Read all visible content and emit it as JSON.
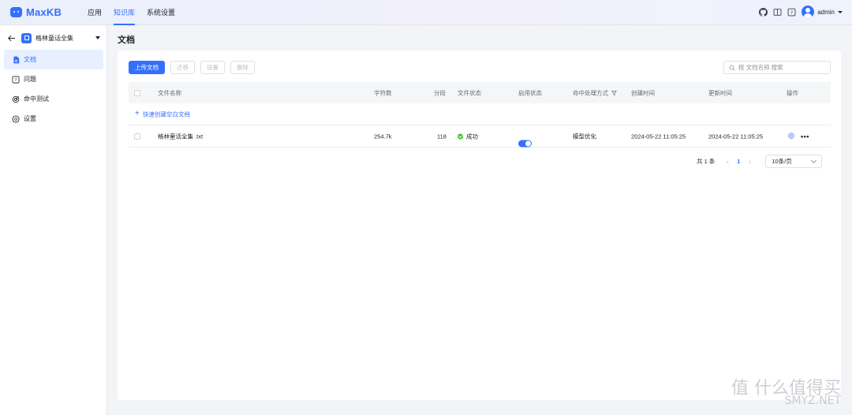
{
  "app": {
    "logo_text": "MaxKB"
  },
  "nav": {
    "items": [
      "应用",
      "知识库",
      "系统设置"
    ],
    "active": "知识库"
  },
  "user": {
    "name": "admin"
  },
  "sidebar": {
    "knowledge_base": "格林童话全集",
    "items": [
      {
        "label": "文档",
        "icon": "document-icon",
        "active": true
      },
      {
        "label": "问题",
        "icon": "question-icon",
        "active": false
      },
      {
        "label": "命中测试",
        "icon": "target-icon",
        "active": false
      },
      {
        "label": "设置",
        "icon": "gear-icon",
        "active": false
      }
    ]
  },
  "main": {
    "title": "文档",
    "toolbar": {
      "upload": "上传文档",
      "migrate": "迁移",
      "settings": "设置",
      "delete": "删除"
    },
    "search": {
      "placeholder": "按 文档名称 搜索"
    },
    "table": {
      "headers": {
        "name": "文件名称",
        "chars": "字符数",
        "segments": "分段",
        "file_status": "文件状态",
        "enable_status": "启用状态",
        "hit_mode": "命中处理方式",
        "created": "创建时间",
        "updated": "更新时间",
        "actions": "操作"
      },
      "quick_create": "快速创建空白文档",
      "rows": [
        {
          "name": "格林童话全集 .txt",
          "chars": "254.7k",
          "segments": "118",
          "file_status": "成功",
          "enabled": true,
          "hit_mode": "模型优化",
          "created": "2024-05-22 11:05:25",
          "updated": "2024-05-22 11:05:25"
        }
      ]
    },
    "pagination": {
      "total": "共 1 条",
      "current_page": "1",
      "page_size": "10条/页"
    }
  },
  "watermark": {
    "top": "值 什么值得买",
    "bottom": "SMYZ.NET"
  },
  "colors": {
    "accent": "#3370ff",
    "success": "#34c724"
  }
}
